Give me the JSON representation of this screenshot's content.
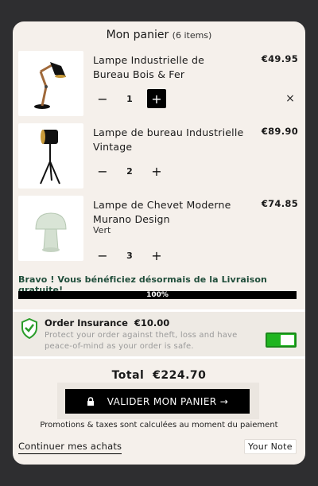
{
  "header": {
    "title": "Mon panier",
    "count": "(6 items)"
  },
  "items": [
    {
      "title": "Lampe Industrielle de Bureau Bois & Fer",
      "price": "€49.95",
      "qty": "1",
      "minus": "−",
      "plus": "+",
      "remove": "×"
    },
    {
      "title": "Lampe de bureau Industrielle Vintage",
      "price": "€89.90",
      "qty": "2",
      "minus": "−",
      "plus": "+"
    },
    {
      "title": "Lampe de Chevet Moderne Murano Design",
      "variant": "Vert",
      "price": "€74.85",
      "qty": "3",
      "minus": "−",
      "plus": "+"
    }
  ],
  "shipping": {
    "prefix": "Bravo ! Vous bénéficiez désormais de la ",
    "highlight": "Livraison gratuite",
    "suffix": "!",
    "progress": "100%",
    "progress_value": 1.0
  },
  "insurance": {
    "title": "Order Insurance",
    "price": "€10.00",
    "description": "Protect your order against theft, loss and have peace-of-mind as your order is safe.",
    "enabled": true,
    "icon": "shield-check-icon"
  },
  "total": {
    "label": "Total",
    "value": "€224.70"
  },
  "checkout": {
    "label": "VALIDER MON PANIER →",
    "icon": "lock-icon"
  },
  "taxes": "Promotions & taxes sont calculées au moment du paiement",
  "footer": {
    "continue": "Continuer mes achats",
    "note": "Your Note"
  },
  "colors": {
    "background": "#2e2e30",
    "panel": "#f5f0eb",
    "accent_green": "#20b520",
    "shipping_text": "#1f4d3a"
  }
}
